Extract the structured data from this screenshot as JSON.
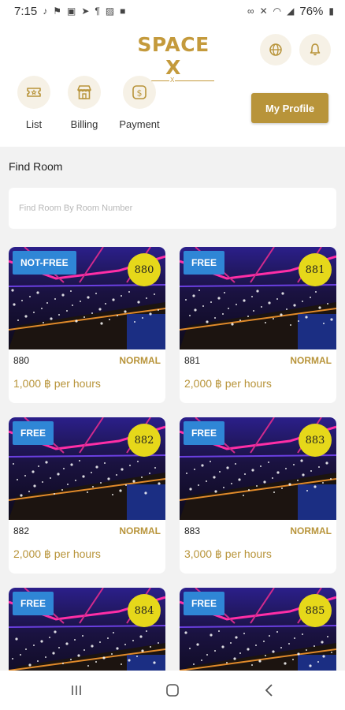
{
  "status_bar": {
    "time": "7:15",
    "battery": "76%",
    "left_icons": [
      "tiktok-icon",
      "notification-icon",
      "shopping-bag-icon",
      "telegram-icon",
      "news-icon",
      "gallery-icon",
      "lock-icon"
    ],
    "right_icons": [
      "link-icon",
      "mute-icon",
      "wifi-icon",
      "signal-icon",
      "battery-icon"
    ]
  },
  "header": {
    "logo_text": "SPACE X",
    "logo_sub": "X",
    "menu": [
      {
        "label": "List",
        "icon": "ticket-icon"
      },
      {
        "label": "Billing",
        "icon": "store-icon"
      },
      {
        "label": "Payment",
        "icon": "dollar-icon"
      }
    ],
    "profile_button": "My Profile",
    "actions": [
      "globe-icon",
      "bell-icon"
    ]
  },
  "main": {
    "find_title": "Find Room",
    "search_placeholder": "Find Room By Room Number",
    "rooms": [
      {
        "badge": "NOT-FREE",
        "number": "880",
        "type": "NORMAL",
        "price": "1,000 ฿ per hours"
      },
      {
        "badge": "FREE",
        "number": "881",
        "type": "NORMAL",
        "price": "2,000 ฿ per hours"
      },
      {
        "badge": "FREE",
        "number": "882",
        "type": "NORMAL",
        "price": "2,000 ฿ per hours"
      },
      {
        "badge": "FREE",
        "number": "883",
        "type": "NORMAL",
        "price": "3,000 ฿ per hours"
      },
      {
        "badge": "FREE",
        "number": "884",
        "type": "",
        "price": ""
      },
      {
        "badge": "FREE",
        "number": "885",
        "type": "",
        "price": ""
      }
    ]
  },
  "nav_bar": {
    "buttons": [
      "recent-apps-icon",
      "home-icon",
      "back-icon"
    ]
  },
  "colors": {
    "gold": "#b8943a",
    "badge_blue": "#2f86d6",
    "room_circle": "#e6d81a",
    "background": "#f2f2f2"
  }
}
